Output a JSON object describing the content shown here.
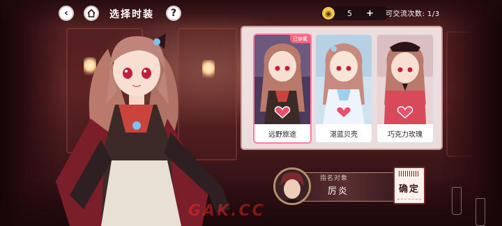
{
  "header": {
    "title": "选择时装"
  },
  "currency": {
    "icon": "coin-icon",
    "amount": "5",
    "plus_label": "+",
    "exchange_text": "可交流次数: 1/3"
  },
  "outfits": [
    {
      "name": "远野旅途",
      "tag": "已穿戴",
      "selected": true
    },
    {
      "name": "湛蓝贝壳",
      "tag": "",
      "selected": false
    },
    {
      "name": "巧克力玫瑰",
      "tag": "",
      "selected": false
    }
  ],
  "target": {
    "label": "指名对象",
    "name": "厉炎"
  },
  "confirm": {
    "label": "确定"
  },
  "watermark": "GAK.CC",
  "colors": {
    "accent_pink": "#f0667e",
    "panel_bg": "#f5e8e8",
    "room_wall": "#5e2426",
    "confirm_border": "#7b2b2f"
  }
}
